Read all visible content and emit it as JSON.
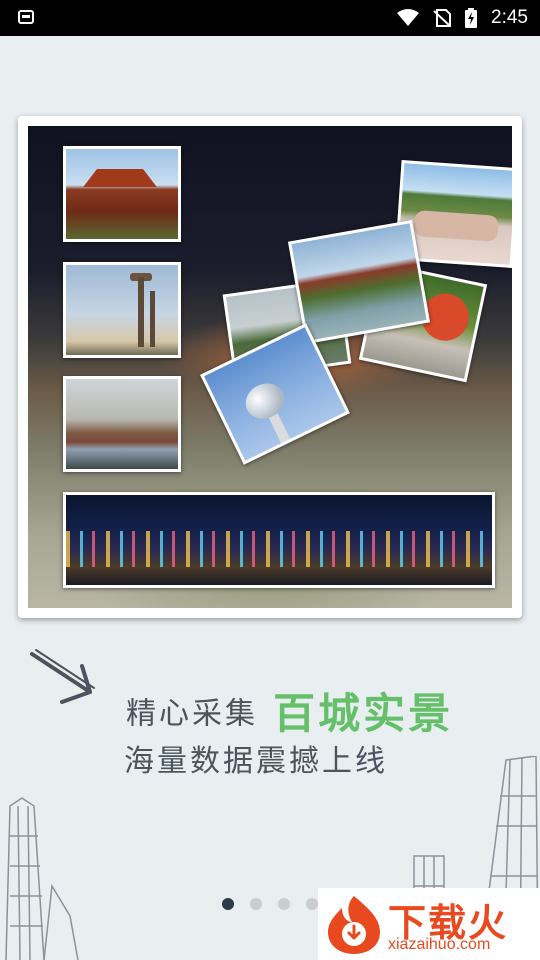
{
  "status_bar": {
    "time": "2:45",
    "icons": [
      "app-notification-icon",
      "wifi-icon",
      "no-sim-icon",
      "battery-charging-icon"
    ]
  },
  "gallery": {
    "photos": [
      "temple",
      "tower",
      "trees-lake",
      "night-city",
      "stone-monument",
      "pavilion",
      "flowers",
      "grey-landscape",
      "tv-tower"
    ]
  },
  "headline": {
    "small": "精心采集",
    "big": "百城实景"
  },
  "subline": "海量数据震撼上线",
  "pagination": {
    "total": 4,
    "active": 1
  },
  "watermark": {
    "title": "下载火",
    "url": "xiazaihuo.com"
  },
  "colors": {
    "accent_green": "#66c06a",
    "text_gray": "#4a5560",
    "background": "#e9eef1",
    "dot_active": "#2f3a48",
    "dot_inactive": "#c9cdd1",
    "watermark_orange": "#e8491f"
  }
}
